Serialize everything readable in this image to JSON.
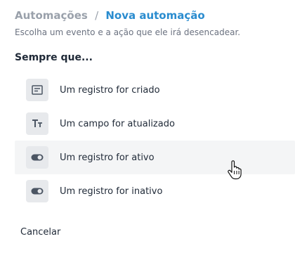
{
  "breadcrumb": {
    "root": "Automações",
    "separator": "/",
    "current": "Nova automação"
  },
  "subtitle": "Escolha um evento e a ação que ele irá desencadear.",
  "section_title": "Sempre que...",
  "options": [
    {
      "label": "Um registro for criado",
      "icon": "record-icon"
    },
    {
      "label": "Um campo for atualizado",
      "icon": "text-field-icon"
    },
    {
      "label": "Um registro for ativo",
      "icon": "toggle-icon",
      "hovered": true
    },
    {
      "label": "Um registro for inativo",
      "icon": "toggle-icon"
    }
  ],
  "cancel_label": "Cancelar",
  "colors": {
    "accent": "#2a8ccf",
    "muted": "#9aa1ab",
    "icon_bg": "#e7e9ec",
    "hover_bg": "#f4f5f6"
  }
}
